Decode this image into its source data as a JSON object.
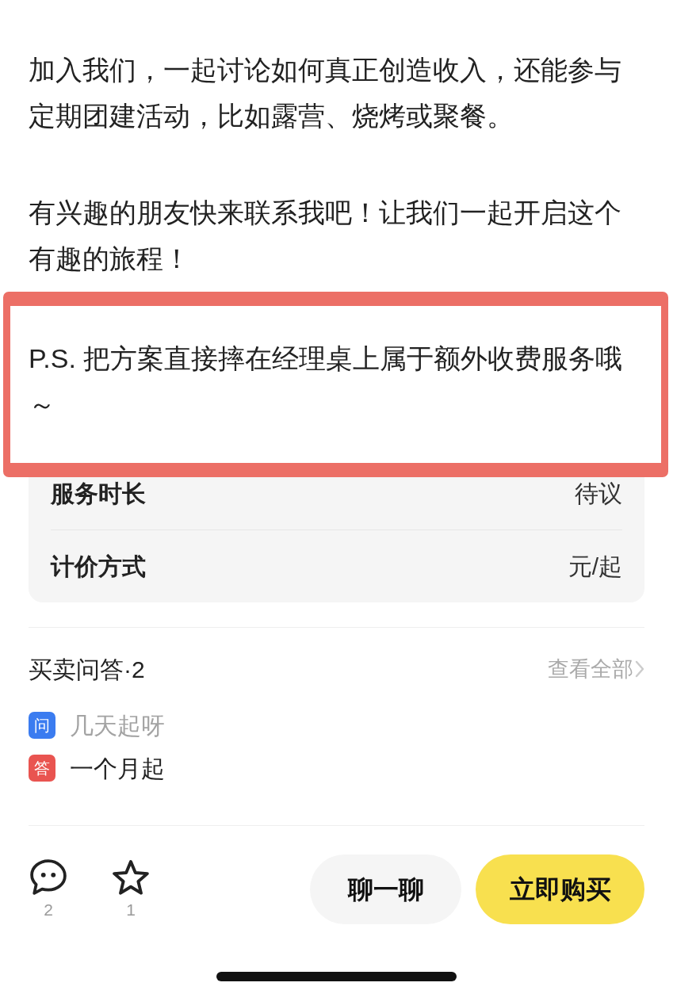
{
  "paragraphs": [
    "加入我们，一起讨论如何真正创造收入，还能参与定期团建活动，比如露营、烧烤或聚餐。",
    "有兴趣的朋友快来联系我吧！让我们一起开启这个有趣的旅程！"
  ],
  "note": {
    "text": "P.S. 把方案直接摔在经理桌上属于额外收费服务哦～",
    "highlighted": true
  },
  "details": [
    {
      "label": "服务时长",
      "value": "待议"
    },
    {
      "label": "计价方式",
      "value": "元/起"
    }
  ],
  "qa": {
    "title": "买卖问答·2",
    "view_all": "查看全部",
    "items": [
      {
        "kind": "question",
        "badge": "问",
        "text": "几天起呀"
      },
      {
        "kind": "answer",
        "badge": "答",
        "text": "一个月起"
      }
    ]
  },
  "bottom_bar": {
    "actions": [
      {
        "kind": "comment",
        "count": "2"
      },
      {
        "kind": "favorite",
        "count": "1"
      }
    ],
    "buttons": [
      {
        "kind": "secondary",
        "label": "聊一聊"
      },
      {
        "kind": "primary",
        "label": "立即购买"
      }
    ]
  }
}
